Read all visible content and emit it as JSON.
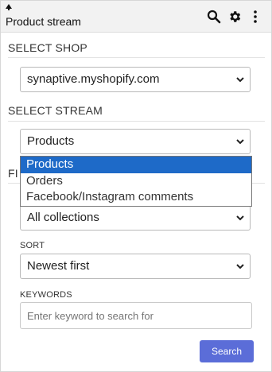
{
  "header": {
    "title": "Product stream",
    "icons": [
      "up-arrow-icon",
      "search-icon",
      "gear-icon",
      "more-vert-icon"
    ]
  },
  "select_shop": {
    "heading": "SELECT SHOP",
    "value": "synaptive.myshopify.com"
  },
  "select_stream": {
    "heading": "SELECT STREAM",
    "value": "Products",
    "options": [
      "Products",
      "Orders",
      "Facebook/Instagram comments"
    ],
    "selected_index": 0
  },
  "filter": {
    "heading_partial": "FI",
    "collection_value": "All collections"
  },
  "sort": {
    "label": "SORT",
    "value": "Newest first"
  },
  "keywords": {
    "label": "KEYWORDS",
    "placeholder": "Enter keyword to search for"
  },
  "search_button": {
    "label": "Search"
  },
  "colors": {
    "accent": "#5b6dd8",
    "selected_option": "#1e6ac8",
    "header_bg": "#f2f2f2"
  }
}
